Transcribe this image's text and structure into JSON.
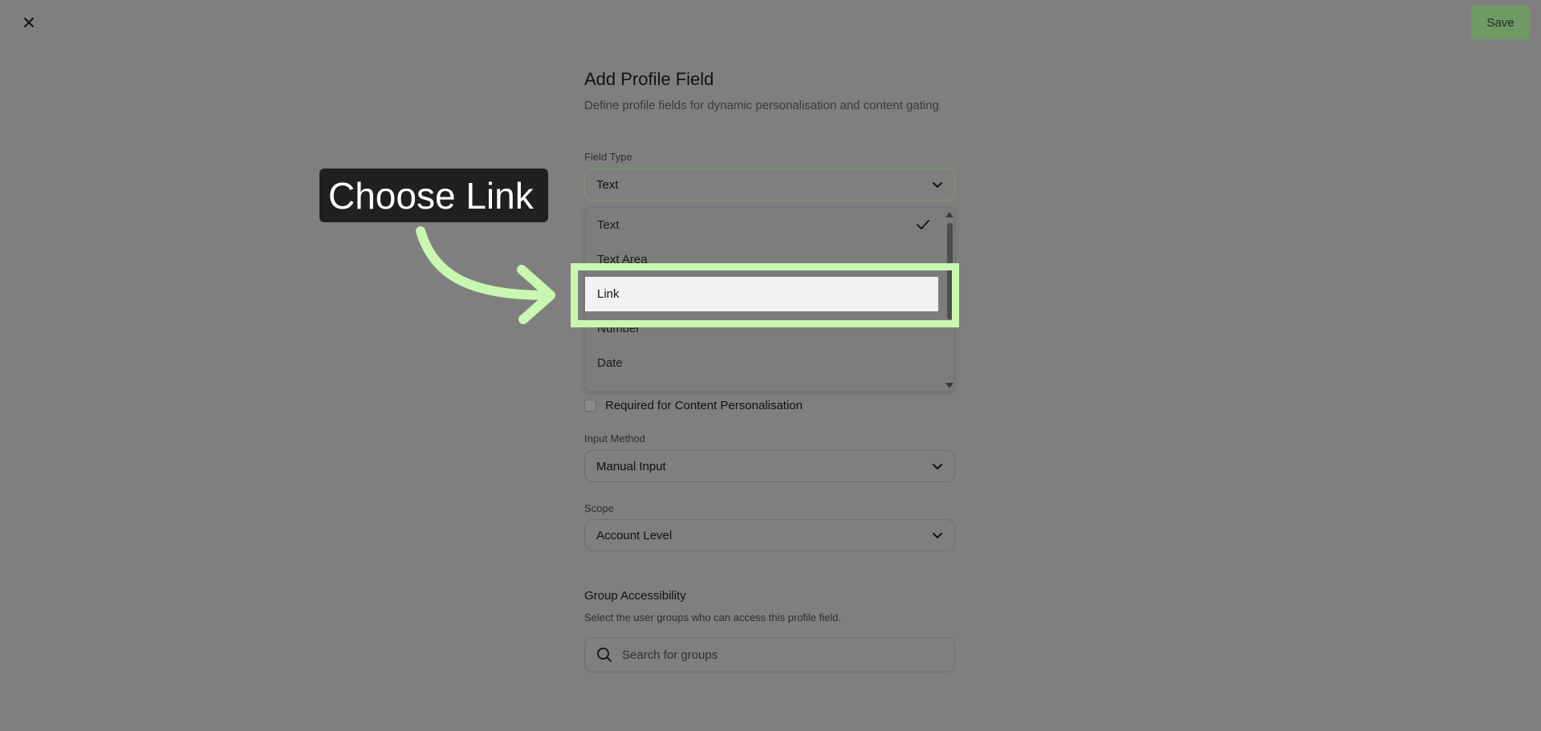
{
  "header": {
    "close_icon": "close-icon",
    "save_label": "Save",
    "save_color": "#6f9a65"
  },
  "form": {
    "title": "Add Profile Field",
    "subtitle": "Define profile fields for dynamic personalisation and content gating",
    "field_type": {
      "label": "Field Type",
      "value": "Text",
      "options": [
        {
          "label": "Text",
          "selected": true
        },
        {
          "label": "Text Area",
          "selected": false
        },
        {
          "label": "Link",
          "selected": false,
          "highlighted": true
        },
        {
          "label": "Number",
          "selected": false
        },
        {
          "label": "Date",
          "selected": false
        }
      ]
    },
    "required_checkbox": {
      "label": "Required for Content Personalisation",
      "checked": false
    },
    "input_method": {
      "label": "Input Method",
      "value": "Manual Input"
    },
    "scope": {
      "label": "Scope",
      "value": "Account Level"
    },
    "group_accessibility": {
      "title": "Group Accessibility",
      "subtitle": "Select the user groups who can access this profile field.",
      "search_placeholder": "Search for groups",
      "search_value": ""
    }
  },
  "annotation": {
    "callout_text": "Choose Link",
    "highlight_color": "#c9f7b0"
  }
}
